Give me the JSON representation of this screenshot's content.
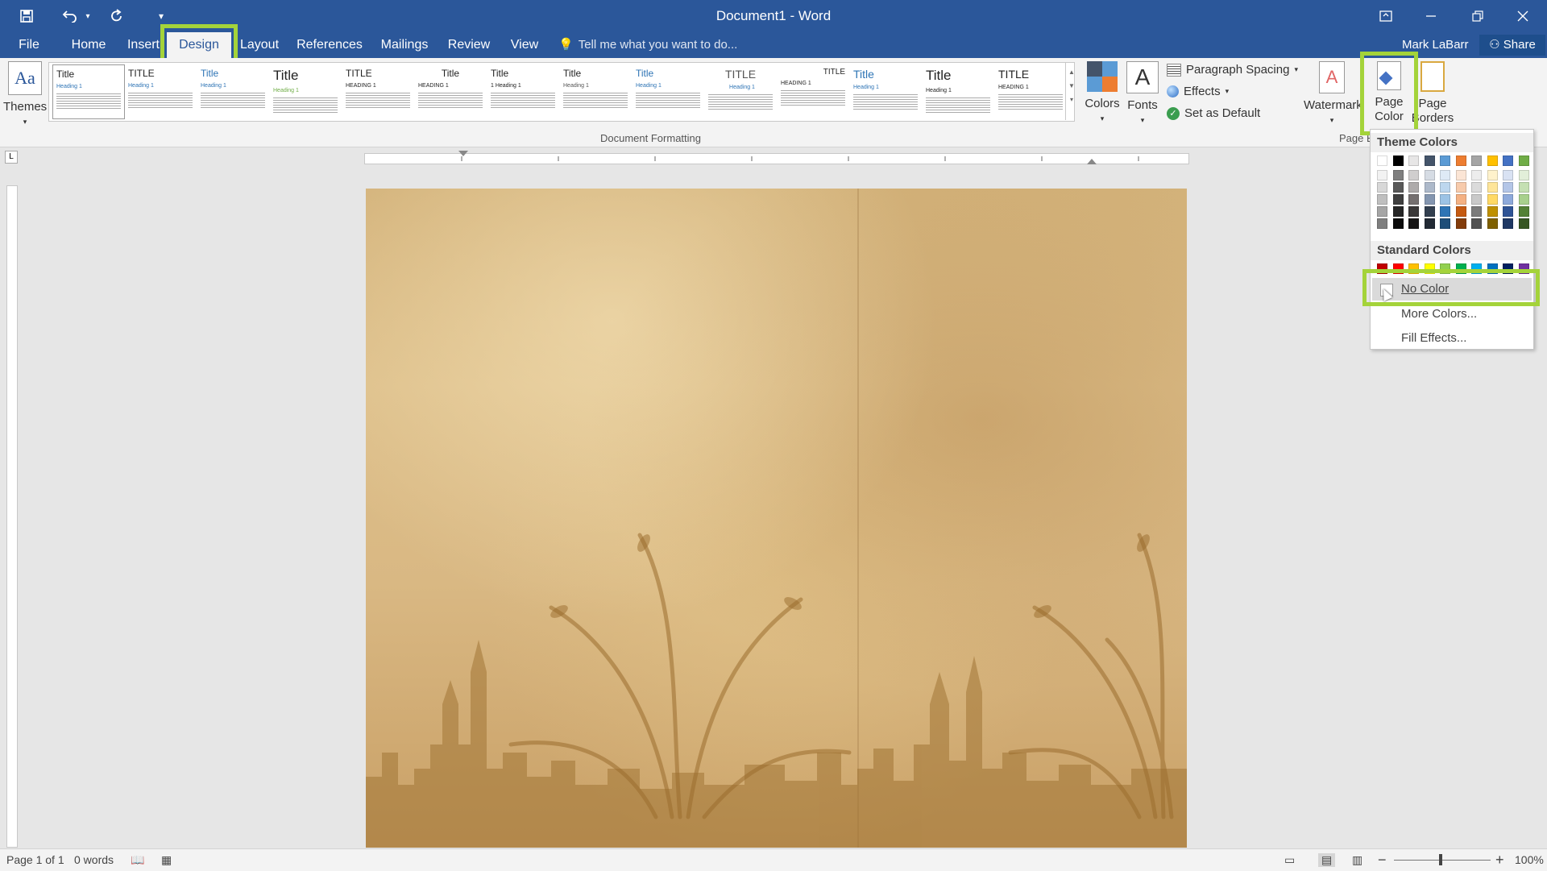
{
  "window": {
    "title": "Document1 - Word"
  },
  "qat": {
    "save": "save-icon",
    "undo": "undo-icon",
    "redo": "redo-icon",
    "customize": "customize-icon"
  },
  "tabs": [
    {
      "label": "File"
    },
    {
      "label": "Home"
    },
    {
      "label": "Insert"
    },
    {
      "label": "Design"
    },
    {
      "label": "Layout"
    },
    {
      "label": "References"
    },
    {
      "label": "Mailings"
    },
    {
      "label": "Review"
    },
    {
      "label": "View"
    }
  ],
  "tellme": {
    "placeholder": "Tell me what you want to do..."
  },
  "user": {
    "name": "Mark LaBarr",
    "share": "Share"
  },
  "ribbon": {
    "themes": "Themes",
    "gallery": [
      {
        "title": "Title",
        "heading": "Heading 1"
      },
      {
        "title": "TITLE",
        "heading": "Heading 1"
      },
      {
        "title": "Title",
        "heading": "Heading 1"
      },
      {
        "title": "Title",
        "heading": "Heading 1"
      },
      {
        "title": "TITLE",
        "heading": "HEADING 1"
      },
      {
        "title": "Title",
        "heading": "HEADING 1"
      },
      {
        "title": "Title",
        "heading": "1 Heading 1"
      },
      {
        "title": "Title",
        "heading": "Heading 1"
      },
      {
        "title": "Title",
        "heading": "Heading 1"
      },
      {
        "title": "TITLE",
        "heading": "Heading 1"
      },
      {
        "title": "TITLE",
        "heading": "HEADING 1"
      },
      {
        "title": "Title",
        "heading": "Heading 1"
      },
      {
        "title": "Title",
        "heading": "Heading 1"
      },
      {
        "title": "TITLE",
        "heading": "HEADING 1"
      }
    ],
    "document_formatting": "Document Formatting",
    "colors": "Colors",
    "fonts": "Fonts",
    "paragraph_spacing": "Paragraph Spacing",
    "effects": "Effects",
    "set_default": "Set as Default",
    "watermark": "Watermark",
    "page_color_1": "Page",
    "page_color_2": "Color",
    "page_borders_1": "Page",
    "page_borders_2": "Borders",
    "page_background_label": "Page B"
  },
  "page_color_menu": {
    "theme_header": "Theme Colors",
    "theme_top": [
      "#ffffff",
      "#000000",
      "#e7e6e6",
      "#44546a",
      "#5b9bd5",
      "#ed7d31",
      "#a5a5a5",
      "#ffc000",
      "#4472c4",
      "#70ad47"
    ],
    "theme_shades": [
      [
        "#f2f2f2",
        "#7f7f7f",
        "#d0cece",
        "#d6dce4",
        "#deeaf6",
        "#fbe5d5",
        "#ededed",
        "#fff2cc",
        "#d9e2f3",
        "#e2efd9"
      ],
      [
        "#d8d8d8",
        "#595959",
        "#aeabab",
        "#adb9ca",
        "#bdd7ee",
        "#f7cbac",
        "#dbdbdb",
        "#fee599",
        "#b4c6e7",
        "#c5e0b3"
      ],
      [
        "#bfbfbf",
        "#3f3f3f",
        "#757070",
        "#8496b0",
        "#9cc3e5",
        "#f4b183",
        "#c9c9c9",
        "#ffd965",
        "#8eaadb",
        "#a8d08d"
      ],
      [
        "#a5a5a5",
        "#262626",
        "#3a3838",
        "#323f4f",
        "#2e75b5",
        "#c55a11",
        "#7b7b7b",
        "#bf9000",
        "#2f5496",
        "#538135"
      ],
      [
        "#7f7f7f",
        "#0c0c0c",
        "#171616",
        "#222a35",
        "#1e4e79",
        "#833c0b",
        "#525252",
        "#7f6000",
        "#1f3864",
        "#375623"
      ]
    ],
    "standard_header": "Standard Colors",
    "standard": [
      "#c00000",
      "#ff0000",
      "#ffc000",
      "#ffff00",
      "#92d050",
      "#00b050",
      "#00b0f0",
      "#0070c0",
      "#002060",
      "#7030a0"
    ],
    "no_color": "No Color",
    "more_colors": "More Colors...",
    "fill_effects": "Fill Effects..."
  },
  "status": {
    "page": "Page 1 of 1",
    "words": "0 words",
    "zoom": "100%"
  }
}
